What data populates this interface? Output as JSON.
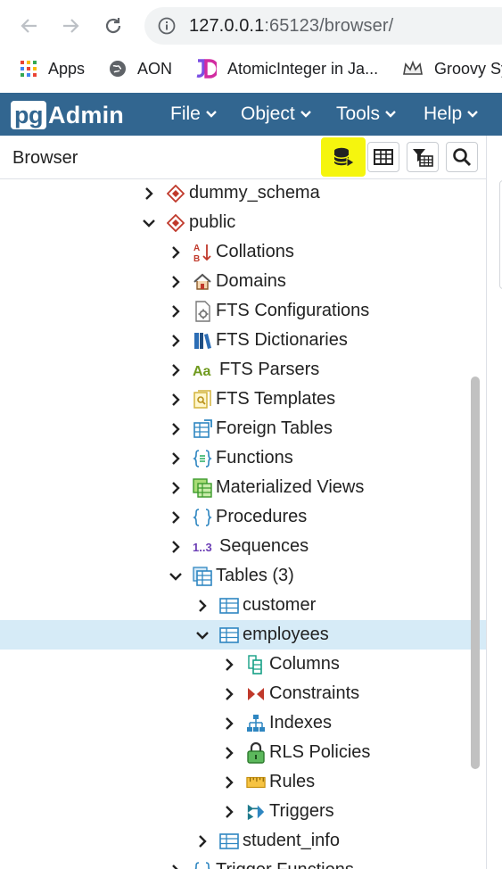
{
  "browser": {
    "url_host": "127.0.0.1",
    "url_rest": ":65123/browser/",
    "bookmarks": [
      "Apps",
      "AON",
      "AtomicInteger in Ja...",
      "Groovy Sy"
    ]
  },
  "app": {
    "logo_pg": "pg",
    "logo_admin": "Admin",
    "menus": [
      "File",
      "Object",
      "Tools",
      "Help"
    ]
  },
  "panel": {
    "title": "Browser"
  },
  "tree": {
    "dummy_schema": "dummy_schema",
    "public": "public",
    "collations": "Collations",
    "domains": "Domains",
    "fts_configurations": "FTS Configurations",
    "fts_dictionaries": "FTS Dictionaries",
    "fts_parsers": "FTS Parsers",
    "fts_templates": "FTS Templates",
    "foreign_tables": "Foreign Tables",
    "functions": "Functions",
    "materialized_views": "Materialized Views",
    "procedures": "Procedures",
    "sequences": "Sequences",
    "tables": "Tables (3)",
    "customer": "customer",
    "employees": "employees",
    "columns": "Columns",
    "constraints": "Constraints",
    "indexes": "Indexes",
    "rls_policies": "RLS Policies",
    "rules": "Rules",
    "triggers": "Triggers",
    "student_info": "student_info",
    "trigger_functions": "Trigger Functions"
  },
  "colors": {
    "header": "#326690",
    "selected_row": "#d6ebf7",
    "highlight": "#f5f50e"
  }
}
